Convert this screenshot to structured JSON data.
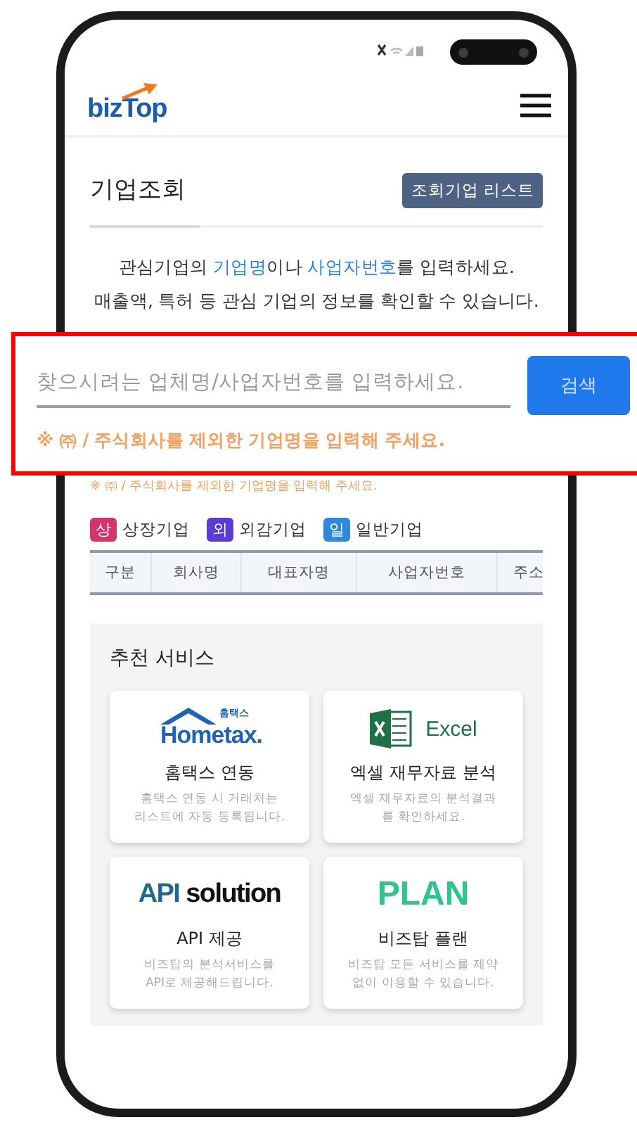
{
  "header": {
    "logo": "bizTop"
  },
  "page": {
    "title": "기업조회",
    "list_button": "조회기업 리스트"
  },
  "intro_lines": [
    [
      {
        "text": "관심기업의 ",
        "highlight": false
      },
      {
        "text": "기업명",
        "highlight": true
      },
      {
        "text": "이나 ",
        "highlight": false
      },
      {
        "text": "사업자번호",
        "highlight": true
      },
      {
        "text": "를 입력하세요.",
        "highlight": false
      }
    ],
    [
      {
        "text": "매출액, 특허 등 관심 기업의 정보를 확인할 수 있습니다.",
        "highlight": false
      }
    ]
  ],
  "search": {
    "note": "※ ㈜ / 주식회사를 제외한 기업명을 입력해 주세요."
  },
  "callout": {
    "placeholder": "찾으시려는 업체명/사업자번호를 입력하세요.",
    "button": "검색",
    "note": "※ ㈜ / 주식회사를 제외한 기업명을 입력해 주세요."
  },
  "legend": [
    {
      "badge": "상",
      "label": "상장기업",
      "color": "#d3336e"
    },
    {
      "badge": "외",
      "label": "외감기업",
      "color": "#5a3bd4"
    },
    {
      "badge": "일",
      "label": "일반기업",
      "color": "#2f88dd"
    }
  ],
  "table": {
    "columns": [
      "구분",
      "회사명",
      "대표자명",
      "사업자번호",
      "주소"
    ]
  },
  "services": {
    "title": "추천 서비스",
    "cards": [
      {
        "kind": "hometax",
        "logo": [
          "홈택스",
          "Hometax."
        ],
        "title": "홈택스 연동",
        "description_lines": [
          "홈택스 연동 시 거래처는",
          "리스트에 자동 등록됩니다."
        ]
      },
      {
        "kind": "excel",
        "logo": [
          "Excel"
        ],
        "title": "엑셀 재무자료 분석",
        "description_lines": [
          "엑셀 재무자료의 분석결과",
          "를 확인하세요."
        ]
      },
      {
        "kind": "api",
        "logo": [
          "API",
          "solution"
        ],
        "title": "API 제공",
        "description_lines": [
          "비즈탑의 분석서비스를",
          "API로 제공해드립니다."
        ]
      },
      {
        "kind": "plan",
        "logo": [
          "PLAN"
        ],
        "title": "비즈탑 플랜",
        "description_lines": [
          "비즈탑 모든 서비스를 제약",
          "없이 이용할 수 있습니다."
        ]
      }
    ]
  }
}
